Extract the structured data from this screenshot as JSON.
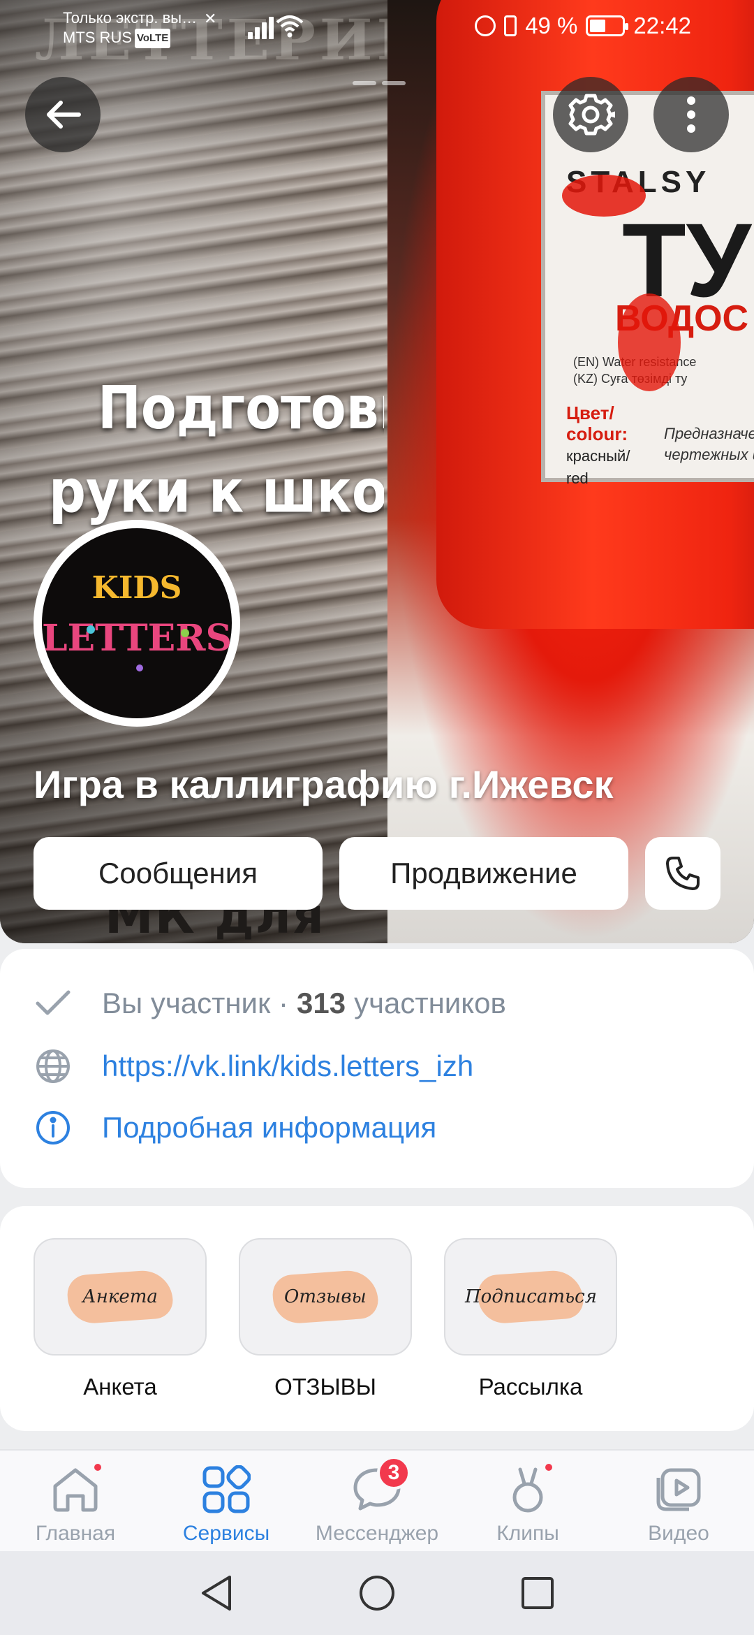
{
  "status_bar": {
    "notification": "Только экстр. вы…",
    "carrier": "MTS RUS",
    "volte": "VoLTE",
    "battery": "49 %",
    "time": "22:42"
  },
  "cover": {
    "background_word": "ЛЕТТЕРИН",
    "promo_line1": "Подготовка",
    "promo_line2": "руки к школе",
    "bottom_word": "МК для",
    "label_brand": "STALSY",
    "label_big": "ТУ",
    "label_sub": "ВОДОС",
    "label_small": "(EN) Water resistance\n(KZ) Суға төзімді ту",
    "label_color": "Цвет/\ncolour:",
    "label_color_value": "красный/\nred",
    "label_purpose": "Предназначен\nчертежных и оф"
  },
  "group": {
    "avatar_text_top": "KIDS",
    "avatar_text_bottom": "LETTERS",
    "title": "Игра в каллиграфию г.Ижевск"
  },
  "actions": {
    "messages": "Сообщения",
    "promotion": "Продвижение"
  },
  "info": {
    "member_prefix": "Вы участник ·",
    "member_count": "313",
    "member_suffix": "участников",
    "link": "https://vk.link/kids.letters_izh",
    "details": "Подробная информация"
  },
  "services": [
    {
      "art": "Анкета",
      "caption": "Анкета"
    },
    {
      "art": "Отзывы",
      "caption": "ОТЗЫВЫ"
    },
    {
      "art": "Подписаться",
      "caption": "Рассылка"
    }
  ],
  "tabs": [
    {
      "label": "Главная",
      "icon": "home-icon",
      "dot": true
    },
    {
      "label": "Сервисы",
      "icon": "services-icon",
      "active": true
    },
    {
      "label": "Мессенджер",
      "icon": "messenger-icon",
      "badge": "3"
    },
    {
      "label": "Клипы",
      "icon": "clips-icon",
      "dot": true
    },
    {
      "label": "Видео",
      "icon": "video-icon"
    }
  ],
  "colors": {
    "accent": "#2d81e0",
    "badge": "#f2394d",
    "secondary_text": "#818c99"
  }
}
